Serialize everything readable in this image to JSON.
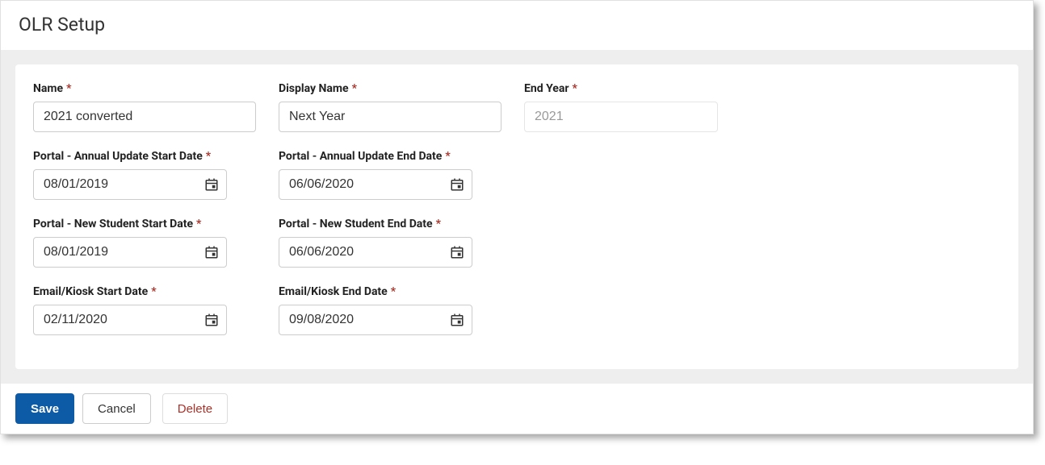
{
  "header": {
    "title": "OLR Setup"
  },
  "fields": {
    "name": {
      "label": "Name",
      "value": "2021 converted"
    },
    "displayName": {
      "label": "Display Name",
      "value": "Next Year"
    },
    "endYear": {
      "label": "End Year",
      "value": "2021"
    },
    "portalAnnualStart": {
      "label": "Portal - Annual Update Start Date",
      "value": "08/01/2019"
    },
    "portalAnnualEnd": {
      "label": "Portal - Annual Update End Date",
      "value": "06/06/2020"
    },
    "portalNewStart": {
      "label": "Portal - New Student Start Date",
      "value": "08/01/2019"
    },
    "portalNewEnd": {
      "label": "Portal - New Student End Date",
      "value": "06/06/2020"
    },
    "emailKioskStart": {
      "label": "Email/Kiosk Start Date",
      "value": "02/11/2020"
    },
    "emailKioskEnd": {
      "label": "Email/Kiosk End Date",
      "value": "09/08/2020"
    }
  },
  "asterisk": "*",
  "buttons": {
    "save": "Save",
    "cancel": "Cancel",
    "delete": "Delete"
  }
}
